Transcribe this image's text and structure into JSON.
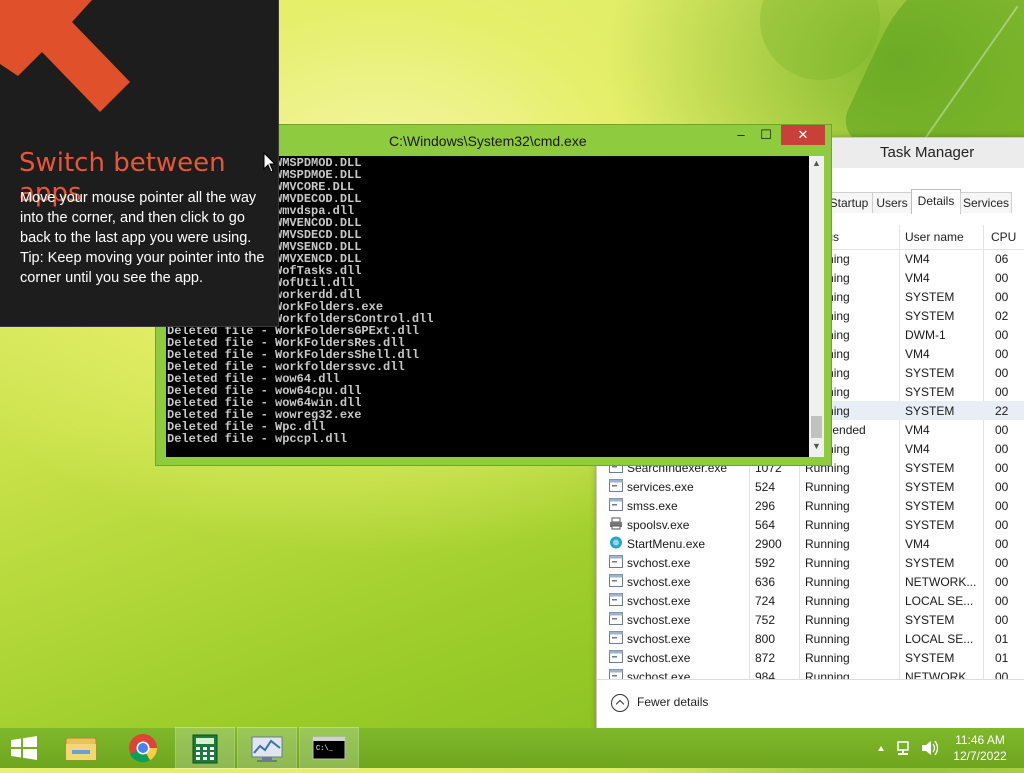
{
  "tip": {
    "title": "Switch between apps",
    "line1": "Move your mouse pointer all the way into the corner, and then click to go back to the last app you were using.",
    "line2": "Tip: Keep moving your pointer into the corner until you see the app."
  },
  "cmd": {
    "title": "C:\\Windows\\System32\\cmd.exe",
    "minimize": "–",
    "maximize": "☐",
    "close": "✕",
    "lines": [
      "Deleted file - WMSPDMOD.DLL",
      "Deleted file - WMSPDMOE.DLL",
      "Deleted file - WMVCORE.DLL",
      "Deleted file - WMVDECOD.DLL",
      "Deleted file - wmvdspa.dll",
      "Deleted file - WMVENCOD.DLL",
      "Deleted file - WMVSDECD.DLL",
      "Deleted file - WMVSENCD.DLL",
      "Deleted file - WMVXENCD.DLL",
      "Deleted file - WofTasks.dll",
      "Deleted file - WofUtil.dll",
      "Deleted file - workerdd.dll",
      "Deleted file - WorkFolders.exe",
      "Deleted file - WorkfoldersControl.dll",
      "Deleted file - WorkFoldersGPExt.dll",
      "Deleted file - WorkFoldersRes.dll",
      "Deleted file - WorkFoldersShell.dll",
      "Deleted file - workfolderssvc.dll",
      "Deleted file - wow64.dll",
      "Deleted file - wow64cpu.dll",
      "Deleted file - wow64win.dll",
      "Deleted file - wowreg32.exe",
      "Deleted file - Wpc.dll",
      "Deleted file - wpccpl.dll"
    ]
  },
  "taskmgr": {
    "title": "Task Manager",
    "tabs": [
      "Startup",
      "Users",
      "Details",
      "Services"
    ],
    "active_tab": "Details",
    "columns": {
      "status": "Status",
      "user": "User name",
      "cpu": "CPU"
    },
    "rows": [
      {
        "name": "",
        "pid": "",
        "status": "Running",
        "user": "VM4",
        "cpu": "06",
        "icon": "app-icon"
      },
      {
        "name": "",
        "pid": "",
        "status": "Running",
        "user": "VM4",
        "cpu": "00",
        "icon": "app-icon"
      },
      {
        "name": "",
        "pid": "",
        "status": "Running",
        "user": "SYSTEM",
        "cpu": "00",
        "icon": "app-icon"
      },
      {
        "name": "",
        "pid": "",
        "status": "Running",
        "user": "SYSTEM",
        "cpu": "02",
        "icon": "app-icon"
      },
      {
        "name": "",
        "pid": "",
        "status": "Running",
        "user": "DWM-1",
        "cpu": "00",
        "icon": "app-icon"
      },
      {
        "name": "",
        "pid": "",
        "status": "Running",
        "user": "VM4",
        "cpu": "00",
        "icon": "app-icon"
      },
      {
        "name": "",
        "pid": "",
        "status": "Running",
        "user": "SYSTEM",
        "cpu": "00",
        "icon": "app-icon"
      },
      {
        "name": "",
        "pid": "",
        "status": "Running",
        "user": "SYSTEM",
        "cpu": "00",
        "icon": "app-icon"
      },
      {
        "name": "",
        "pid": "",
        "status": "Running",
        "user": "SYSTEM",
        "cpu": "22",
        "icon": "app-icon",
        "selected": true
      },
      {
        "name": "",
        "pid": "",
        "status": "Suspended",
        "user": "VM4",
        "cpu": "00",
        "icon": "app-icon"
      },
      {
        "name": "",
        "pid": "",
        "status": "Running",
        "user": "VM4",
        "cpu": "00",
        "icon": "app-icon"
      },
      {
        "name": "SearchIndexer.exe",
        "pid": "1072",
        "status": "Running",
        "user": "SYSTEM",
        "cpu": "00",
        "icon": "app-icon"
      },
      {
        "name": "services.exe",
        "pid": "524",
        "status": "Running",
        "user": "SYSTEM",
        "cpu": "00",
        "icon": "app-icon"
      },
      {
        "name": "smss.exe",
        "pid": "296",
        "status": "Running",
        "user": "SYSTEM",
        "cpu": "00",
        "icon": "app-icon"
      },
      {
        "name": "spoolsv.exe",
        "pid": "564",
        "status": "Running",
        "user": "SYSTEM",
        "cpu": "00",
        "icon": "printer-icon"
      },
      {
        "name": "StartMenu.exe",
        "pid": "2900",
        "status": "Running",
        "user": "VM4",
        "cpu": "00",
        "icon": "startmenu-icon"
      },
      {
        "name": "svchost.exe",
        "pid": "592",
        "status": "Running",
        "user": "SYSTEM",
        "cpu": "00",
        "icon": "app-icon"
      },
      {
        "name": "svchost.exe",
        "pid": "636",
        "status": "Running",
        "user": "NETWORK...",
        "cpu": "00",
        "icon": "app-icon"
      },
      {
        "name": "svchost.exe",
        "pid": "724",
        "status": "Running",
        "user": "LOCAL SE...",
        "cpu": "00",
        "icon": "app-icon"
      },
      {
        "name": "svchost.exe",
        "pid": "752",
        "status": "Running",
        "user": "SYSTEM",
        "cpu": "00",
        "icon": "app-icon"
      },
      {
        "name": "svchost.exe",
        "pid": "800",
        "status": "Running",
        "user": "LOCAL SE...",
        "cpu": "01",
        "icon": "app-icon"
      },
      {
        "name": "svchost.exe",
        "pid": "872",
        "status": "Running",
        "user": "SYSTEM",
        "cpu": "01",
        "icon": "app-icon"
      },
      {
        "name": "svchost.exe",
        "pid": "984",
        "status": "Running",
        "user": "NETWORK",
        "cpu": "00",
        "icon": "app-icon"
      }
    ],
    "footer": "Fewer details"
  },
  "taskbar": {
    "items": [
      "start-icon",
      "file-explorer-icon",
      "chrome-icon",
      "calculator-icon",
      "resource-monitor-icon",
      "cmd-icon"
    ],
    "time": "11:46 AM",
    "date": "12/7/2022"
  }
}
